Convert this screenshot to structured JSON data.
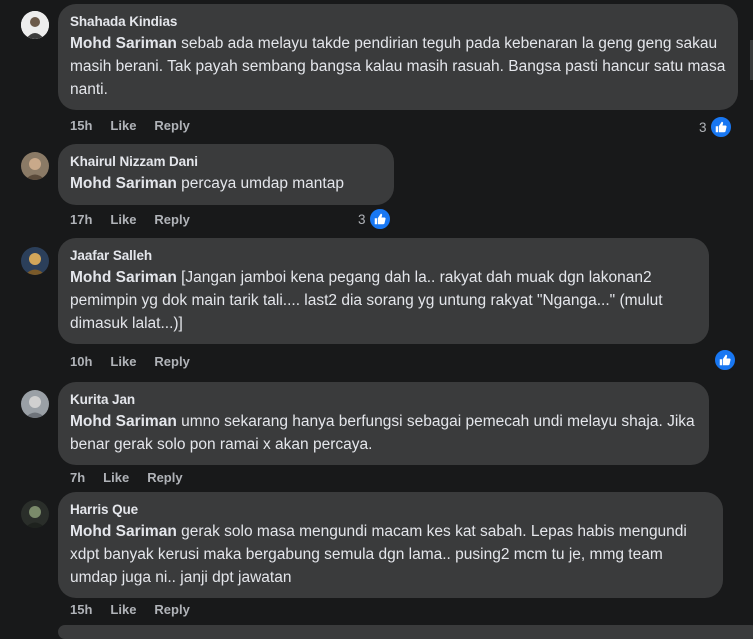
{
  "comments": [
    {
      "author": "Shahada Kindias",
      "mention": "Mohd Sariman",
      "text": " sebab ada melayu takde pendirian teguh pada kebenaran la geng geng sakau masih berani. Tak payah sembang bangsa kalau masih rasuah. Bangsa pasti hancur satu masa nanti.",
      "time": "15h",
      "like_label": "Like",
      "reply_label": "Reply",
      "reaction_count": "3"
    },
    {
      "author": "Khairul Nizzam Dani",
      "mention": "Mohd Sariman",
      "text": " percaya umdap mantap",
      "time": "17h",
      "like_label": "Like",
      "reply_label": "Reply",
      "reaction_count": "3"
    },
    {
      "author": "Jaafar Salleh",
      "mention": "Mohd Sariman",
      "text": " [Jangan jamboi kena pegang dah la.. rakyat dah muak dgn lakonan2 pemimpin yg dok main tarik tali.... last2 dia sorang yg untung rakyat \"Nganga...\" (mulut dimasuk lalat...)]",
      "time": "10h",
      "like_label": "Like",
      "reply_label": "Reply",
      "reaction_count": ""
    },
    {
      "author": "Kurita Jan",
      "mention": "Mohd Sariman",
      "text": " umno sekarang hanya berfungsi sebagai pemecah undi melayu shaja. Jika benar gerak solo pon ramai x akan percaya.",
      "time": "7h",
      "like_label": "Like",
      "reply_label": "Reply"
    },
    {
      "author": "Harris Que",
      "mention": "Mohd Sariman",
      "text": " gerak solo masa mengundi macam kes kat sabah. Lepas habis mengundi xdpt banyak kerusi maka bergabung semula dgn lama.. pusing2 mcm tu je, mmg team umdap juga ni.. janji dpt jawatan",
      "time": "15h",
      "like_label": "Like",
      "reply_label": "Reply"
    }
  ],
  "colors": {
    "background": "#18191a",
    "bubble": "#3a3b3c",
    "text": "#e4e6eb",
    "meta": "#b0b3b8",
    "like_blue": "#1877f2"
  },
  "icons": {
    "reaction": "like-icon"
  }
}
